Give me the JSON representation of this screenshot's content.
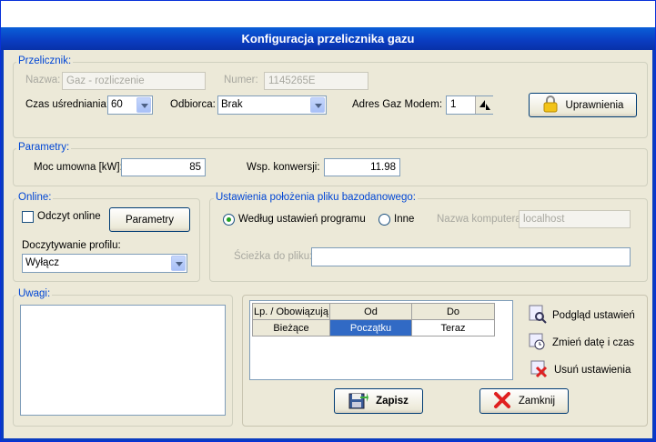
{
  "window": {
    "title": "Konfiguracja przelicznika gazu"
  },
  "przelicznik": {
    "group_label": "Przelicznik:",
    "nazwa_label": "Nazwa:",
    "nazwa_value": "Gaz - rozliczenie",
    "numer_label": "Numer:",
    "numer_value": "1145265E",
    "czas_label": "Czas uśredniania:",
    "czas_value": "60",
    "odbiorca_label": "Odbiorca:",
    "odbiorca_value": "Brak",
    "adres_label": "Adres Gaz Modem:",
    "adres_value": "1",
    "uprawnienia_label": "Uprawnienia"
  },
  "parametry": {
    "group_label": "Parametry:",
    "moc_label": "Moc umowna [kW]:",
    "moc_value": "85",
    "wsp_label": "Wsp. konwersji:",
    "wsp_value": "11.98"
  },
  "online": {
    "group_label": "Online:",
    "odczyt_label": "Odczyt online",
    "parametry_button": "Parametry",
    "doczyt_label": "Doczytywanie profilu:",
    "doczyt_value": "Wyłącz"
  },
  "baza": {
    "group_label": "Ustawienia położenia pliku bazodanowego:",
    "radio_program": "Według ustawień programu",
    "radio_inne": "Inne",
    "komputer_label": "Nazwa komputera:",
    "komputer_value": "localhost",
    "sciezka_label": "Ścieżka do pliku:",
    "sciezka_value": ""
  },
  "uwagi": {
    "group_label": "Uwagi:"
  },
  "grid": {
    "headers": [
      "Lp. / Obowiązują",
      "Od",
      "Do"
    ],
    "rows": [
      [
        "Bieżące",
        "Początku",
        "Teraz"
      ]
    ]
  },
  "actions": {
    "podglad": "Podgląd ustawień",
    "zmien": "Zmień datę i czas",
    "usun": "Usuń ustawienia",
    "zapisz": "Zapisz",
    "zamknij": "Zamknij"
  }
}
